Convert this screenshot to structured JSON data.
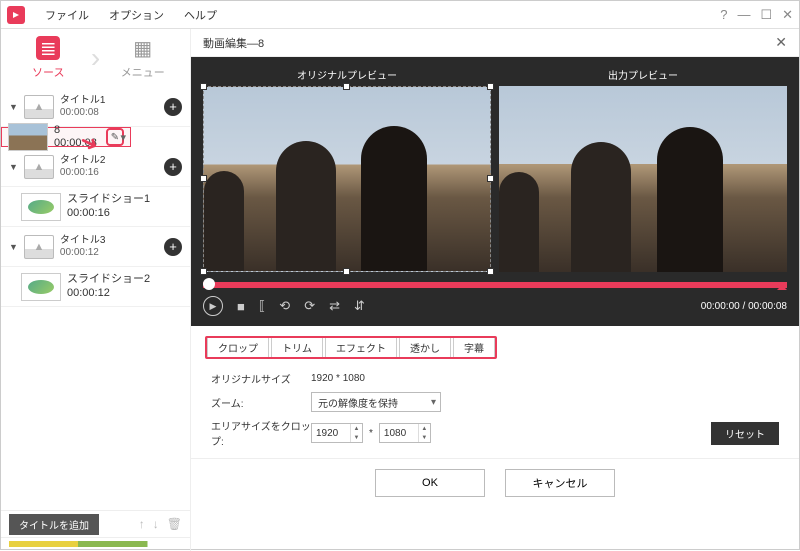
{
  "menu": {
    "file": "ファイル",
    "option": "オプション",
    "help": "ヘルプ"
  },
  "win": {
    "help": "?",
    "min": "—",
    "max": "☐",
    "close": "✕"
  },
  "mainTabs": {
    "source": "ソース",
    "menu": "メニュー"
  },
  "sidebar": {
    "titles": [
      {
        "name": "タイトル1",
        "dur": "00:00:08",
        "clips": [
          {
            "name": "8",
            "dur": "00:00:08",
            "selected": true
          }
        ]
      },
      {
        "name": "タイトル2",
        "dur": "00:00:16",
        "clips": [
          {
            "name": "スライドショー1",
            "dur": "00:00:16",
            "slide": true
          }
        ]
      },
      {
        "name": "タイトル3",
        "dur": "00:00:12",
        "clips": [
          {
            "name": "スライドショー2",
            "dur": "00:00:12",
            "slide": true
          }
        ]
      }
    ],
    "addTitle": "タイトルを追加"
  },
  "dialog": {
    "title": "動画編集—8",
    "origPreview": "オリジナルプレビュー",
    "outPreview": "出力プレビュー",
    "timeCur": "00:00:00",
    "timeTotal": "00:00:08",
    "tabs": {
      "crop": "クロップ",
      "trim": "トリム",
      "effect": "エフェクト",
      "watermark": "透かし",
      "subtitle": "字幕"
    },
    "form": {
      "origSizeLabel": "オリジナルサイズ",
      "origSizeVal": "1920 * 1080",
      "zoomLabel": "ズーム:",
      "zoomVal": "元の解像度を保持",
      "areaLabel": "エリアサイズをクロップ:",
      "w": "1920",
      "h": "1080",
      "sep": "*",
      "reset": "リセット"
    },
    "ok": "OK",
    "cancel": "キャンセル"
  }
}
